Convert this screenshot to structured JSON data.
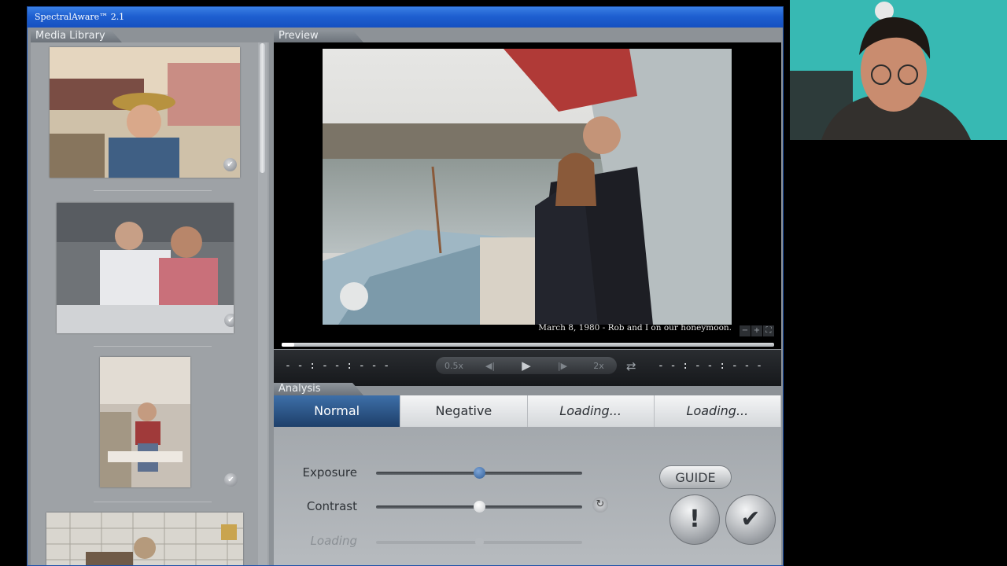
{
  "app": {
    "title": "SpectralAware™ 2.1"
  },
  "library": {
    "tab_label": "Media Library"
  },
  "preview": {
    "tab_label": "Preview",
    "caption": "March 8, 1980 - Rob and I on our honeymoon.",
    "zoom_controls": [
      "−",
      "+",
      "⛶"
    ],
    "progress": 0.025
  },
  "transport": {
    "time_left": "- - : - - : - - -",
    "time_right": "- - : - - : - - -",
    "slow_label": "0.5x",
    "fast_label": "2x",
    "icons": [
      "step-back-icon",
      "play-icon",
      "step-forward-icon",
      "loop-icon"
    ]
  },
  "analysis": {
    "tab_label": "Analysis",
    "modes": [
      "Normal",
      "Negative",
      "Loading...",
      "Loading..."
    ],
    "active_mode": "Normal",
    "sliders": [
      {
        "label": "Exposure",
        "value": 0.5
      },
      {
        "label": "Contrast",
        "value": 0.5
      },
      {
        "label": "Loading",
        "value": 0.5
      }
    ],
    "guide_label": "GUIDE",
    "alert_symbol": "!",
    "confirm_symbol": "✔"
  },
  "colors": {
    "titlebar": "#1e5fd0",
    "active_mode": "#2d5b96",
    "panel_bg": "#9ea2a6"
  }
}
